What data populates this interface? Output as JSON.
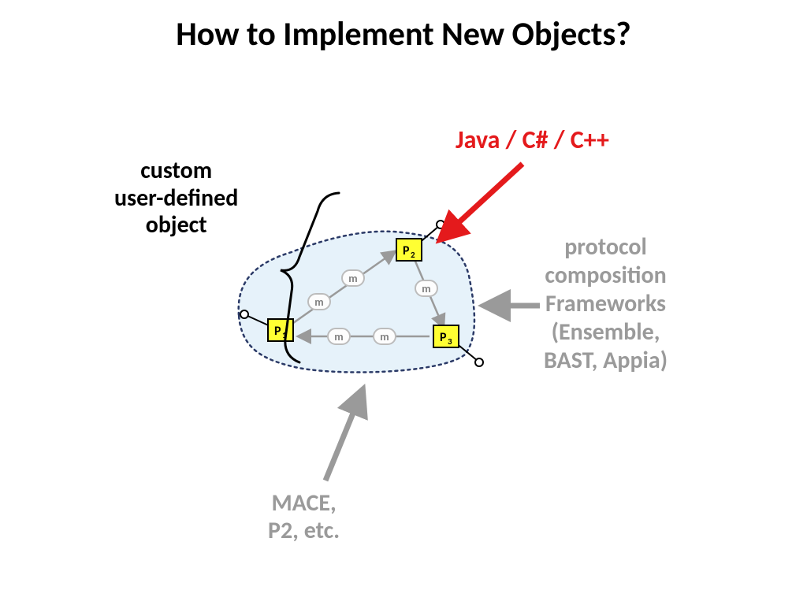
{
  "title": "How to Implement New Objects?",
  "labels": {
    "custom_l1": "custom",
    "custom_l2": "user-defined",
    "custom_l3": "object",
    "java": "Java / C# / C++",
    "protocol_l1": "protocol",
    "protocol_l2": "composition",
    "protocol_l3": "Frameworks",
    "protocol_l4": "(Ensemble,",
    "protocol_l5": "BAST, Appia)",
    "mace_l1": "MACE,",
    "mace_l2": "P2, etc."
  },
  "nodes": {
    "p1": "P",
    "p1_sub": "1",
    "p2": "P",
    "p2_sub": "2",
    "p3": "P",
    "p3_sub": "3"
  },
  "msg": "m"
}
